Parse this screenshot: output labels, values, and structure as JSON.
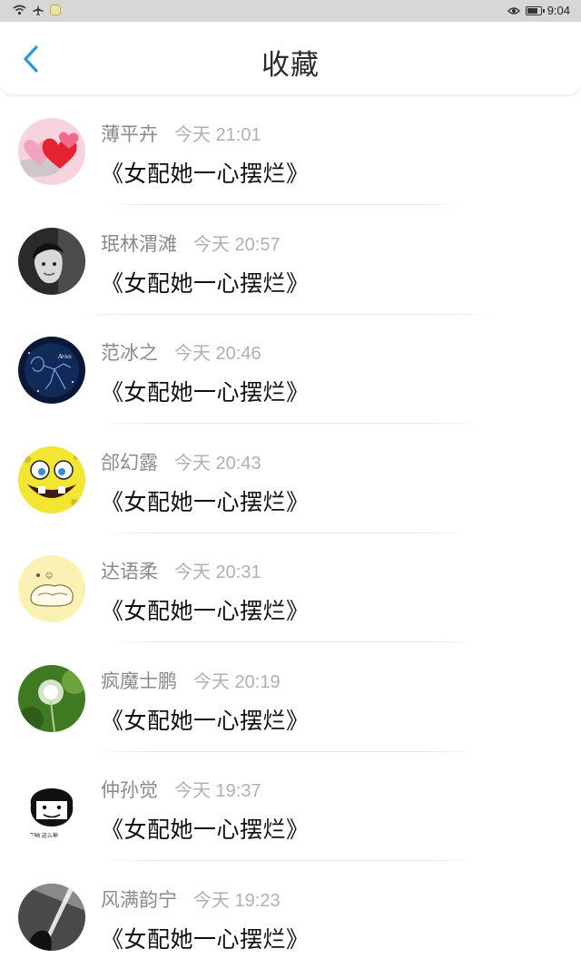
{
  "status_bar": {
    "time": "9:04",
    "left_icons": [
      "wifi-icon",
      "airplane-icon",
      "wechat-notification-icon"
    ],
    "right_icons": [
      "eye-icon",
      "battery-icon"
    ]
  },
  "header": {
    "title": "收藏",
    "back_icon": "chevron-left-icon",
    "accent_color": "#2b97dd"
  },
  "favorites": [
    {
      "name": "薄平卉",
      "time": "今天 21:01",
      "book": "《女配她一心摆烂》",
      "avatar": "hearts-avatar"
    },
    {
      "name": "珉林渭滩",
      "time": "今天 20:57",
      "book": "《女配她一心摆烂》",
      "avatar": "child-photo-avatar"
    },
    {
      "name": "范冰之",
      "time": "今天 20:46",
      "book": "《女配她一心摆烂》",
      "avatar": "aries-constellation-avatar"
    },
    {
      "name": "郃幻露",
      "time": "今天 20:43",
      "book": "《女配她一心摆烂》",
      "avatar": "spongebob-avatar"
    },
    {
      "name": "达语柔",
      "time": "今天 20:31",
      "book": "《女配她一心摆烂》",
      "avatar": "cartoon-bread-avatar"
    },
    {
      "name": "疯魔士鹏",
      "time": "今天 20:19",
      "book": "《女配她一心摆烂》",
      "avatar": "dandelion-avatar"
    },
    {
      "name": "仲孙觉",
      "time": "今天 19:37",
      "book": "《女配她一心摆烂》",
      "avatar": "meme-face-avatar"
    },
    {
      "name": "风满韵宁",
      "time": "今天 19:23",
      "book": "《女配她一心摆烂》",
      "avatar": "dark-light-avatar"
    }
  ]
}
